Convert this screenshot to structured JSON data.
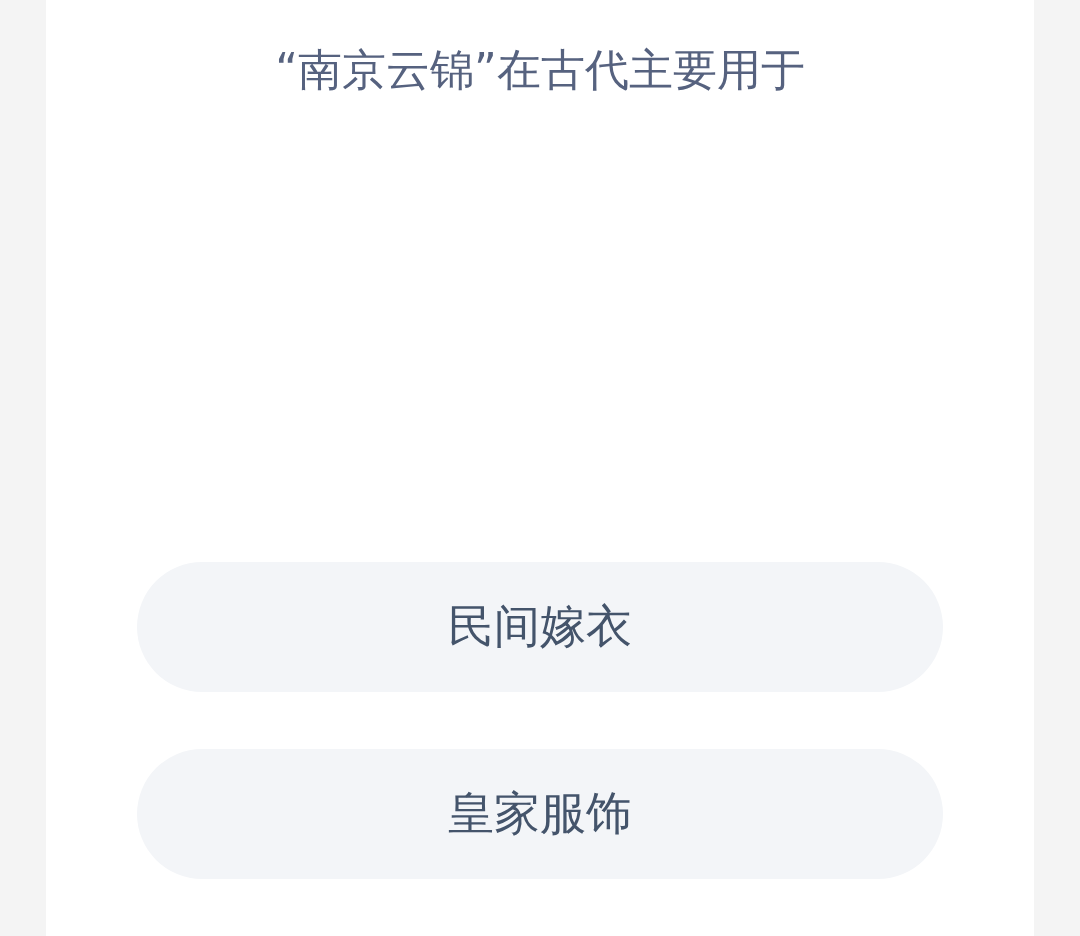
{
  "question": "“南京云锦”在古代主要用于",
  "options": [
    {
      "label": "民间嫁衣"
    },
    {
      "label": "皇家服饰"
    }
  ]
}
